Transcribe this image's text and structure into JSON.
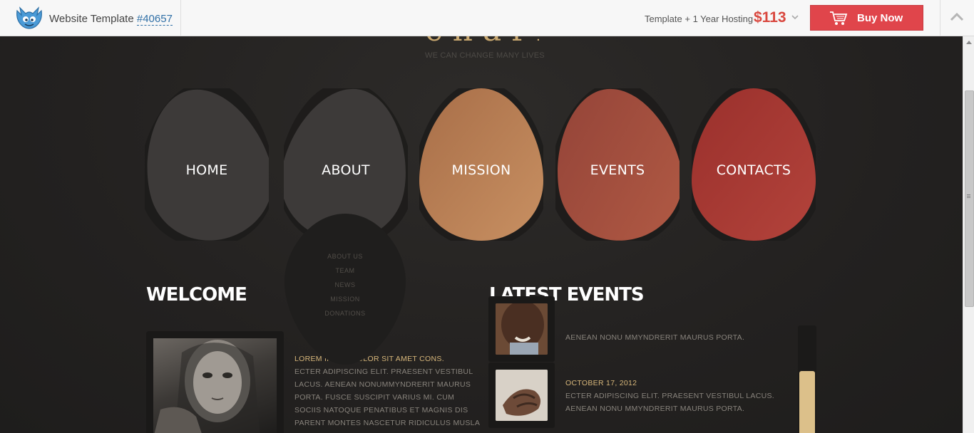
{
  "topbar": {
    "template_label": "Website Template",
    "template_number": "#40657",
    "hosting_label": "Template + 1 Year Hosting",
    "price": "$113",
    "buy_label": "Buy Now"
  },
  "site": {
    "brand": "charity",
    "tagline": "WE CAN CHANGE MANY LIVES",
    "nav": [
      {
        "label": "HOME",
        "color": "#3d3a39"
      },
      {
        "label": "ABOUT",
        "color": "#3d3a39"
      },
      {
        "label": "MISSION",
        "color": "#b77a52"
      },
      {
        "label": "EVENTS",
        "color": "#a04d3e"
      },
      {
        "label": "CONTACTS",
        "color": "#a93832"
      }
    ],
    "submenu": [
      "ABOUT US",
      "TEAM",
      "NEWS",
      "MISSION",
      "DONATIONS"
    ],
    "welcome": {
      "heading": "WELCOME",
      "lead": "LOREM IPSUM DOLOR SIT AMET CONS.",
      "body": "ECTER ADIPISCING ELIT. PRAESENT VESTIBUL LACUS. AENEAN NONUMMYNDRERIT MAURUS PORTA. FUSCE SUSCIPIT VARIUS MI. CUM SOCIIS NATOQUE PENATIBUS ET MAGNIS DIS PARENT MONTES NASCETUR RIDICULUS MUSLA DUSCE"
    },
    "events": {
      "heading": "LATEST EVENTS",
      "items": [
        {
          "date": "",
          "text": "AENEAN NONU MMYNDRERIT MAURUS PORTA."
        },
        {
          "date": "OCTOBER 17, 2012",
          "text": "ECTER ADIPISCING ELIT. PRAESENT VESTIBUL LACUS. AENEAN NONU MMYNDRERIT MAURUS PORTA."
        }
      ]
    },
    "accent_color": "#d6b67a"
  }
}
